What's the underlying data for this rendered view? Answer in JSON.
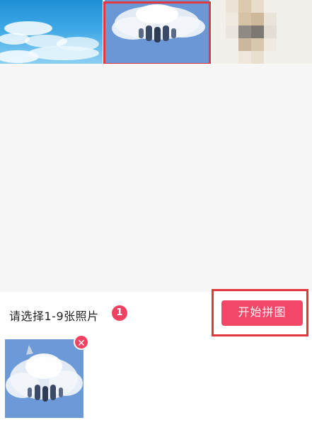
{
  "hint_text": "请选择1-9张照片",
  "selected_count": "1",
  "start_button_label": "开始拼图",
  "remove_glyph": "✕",
  "colors": {
    "accent": "#f24766",
    "selection_frame": "#e2373f",
    "browse_background": "#f7f7f7"
  },
  "gallery": [
    {
      "name": "sky-photo",
      "selected": false
    },
    {
      "name": "jet-photo",
      "selected": true
    },
    {
      "name": "pixelated-photo",
      "selected": false
    }
  ],
  "selected_photos": [
    {
      "name": "jet-photo"
    }
  ]
}
